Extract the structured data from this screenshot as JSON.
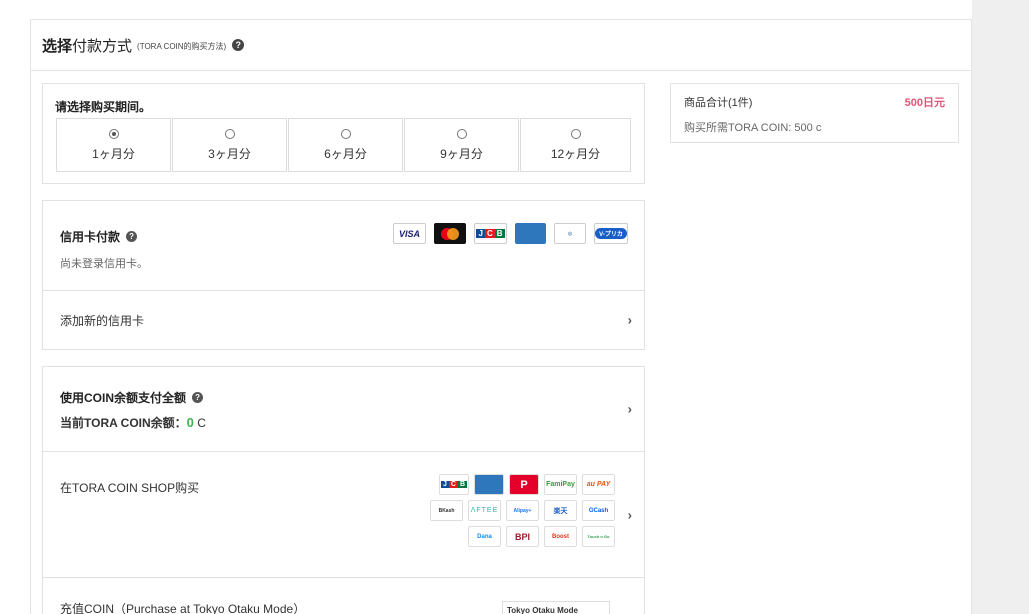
{
  "header": {
    "title_bold": "选择",
    "title_rest": "付款方式",
    "subtitle": "(TORA COIN的购买方法)",
    "help_glyph": "?"
  },
  "period": {
    "title": "请选择购买期间。",
    "options": [
      {
        "label": "1ヶ月分",
        "selected": true
      },
      {
        "label": "3ヶ月分",
        "selected": false
      },
      {
        "label": "6ヶ月分",
        "selected": false
      },
      {
        "label": "9ヶ月分",
        "selected": false
      },
      {
        "label": "12ヶ月分",
        "selected": false
      }
    ]
  },
  "credit": {
    "title": "信用卡付款",
    "note": "尚未登录信用卡。",
    "logos": [
      "VISA",
      "Mastercard",
      "JCB",
      "AMERICAN EXPRESS",
      "Diners Club",
      "V-プリカ"
    ],
    "add_label": "添加新的信用卡"
  },
  "coin": {
    "title": "使用COIN余额支付全额",
    "balance_prefix": "当前TORA COIN余额：",
    "balance_value": "0",
    "balance_unit": "C",
    "shop_label": "在TORA COIN SHOP购买",
    "shop_logos_row1": [
      "JCB",
      "AMEX",
      "P",
      "FamiPay",
      "au PAY"
    ],
    "shop_logos_row2": [
      "BKash",
      "ΛFTEE",
      "Alipay+",
      "楽天",
      "GCash"
    ],
    "shop_logos_row3": [
      "Dana",
      "BPI",
      "Boost",
      "Touch n Go"
    ],
    "bottom_label": "充值COIN（Purchase at Tokyo Otaku Mode）",
    "bottom_logo": "Tokyo Otaku Mode"
  },
  "summary": {
    "label": "商品合计(1件)",
    "price": "500日元",
    "coin_needed": "购买所需TORA COIN: 500 c"
  },
  "colors": {
    "price": "#e05577",
    "balance": "#3cb44b"
  }
}
